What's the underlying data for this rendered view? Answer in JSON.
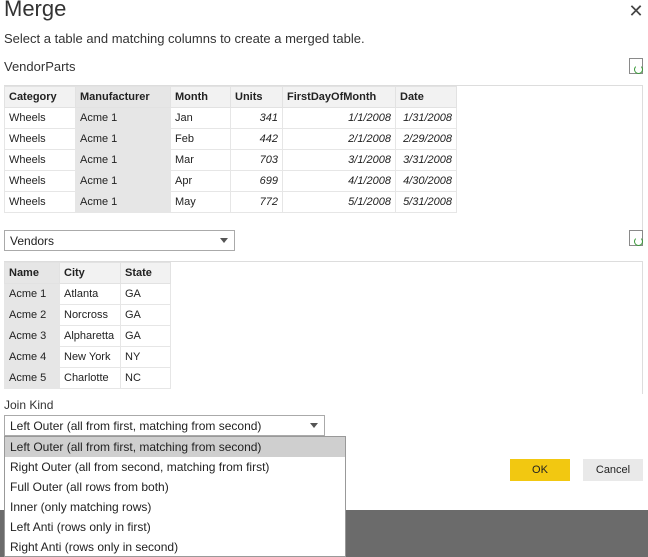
{
  "dialog": {
    "title": "Merge",
    "close_symbol": "✕",
    "subtitle": "Select a table and matching columns to create a merged table."
  },
  "first_table": {
    "name": "VendorParts",
    "columns": [
      "Category",
      "Manufacturer",
      "Month",
      "Units",
      "FirstDayOfMonth",
      "Date"
    ],
    "rows": [
      [
        "Wheels",
        "Acme 1",
        "Jan",
        "341",
        "1/1/2008",
        "1/31/2008"
      ],
      [
        "Wheels",
        "Acme 1",
        "Feb",
        "442",
        "2/1/2008",
        "2/29/2008"
      ],
      [
        "Wheels",
        "Acme 1",
        "Mar",
        "703",
        "3/1/2008",
        "3/31/2008"
      ],
      [
        "Wheels",
        "Acme 1",
        "Apr",
        "699",
        "4/1/2008",
        "4/30/2008"
      ],
      [
        "Wheels",
        "Acme 1",
        "May",
        "772",
        "5/1/2008",
        "5/31/2008"
      ]
    ],
    "selected_column": "Manufacturer"
  },
  "second_table": {
    "selected": "Vendors",
    "columns": [
      "Name",
      "City",
      "State"
    ],
    "rows": [
      [
        "Acme 1",
        "Atlanta",
        "GA"
      ],
      [
        "Acme 2",
        "Norcross",
        "GA"
      ],
      [
        "Acme 3",
        "Alpharetta",
        "GA"
      ],
      [
        "Acme 4",
        "New York",
        "NY"
      ],
      [
        "Acme 5",
        "Charlotte",
        "NC"
      ]
    ],
    "selected_column": "Name"
  },
  "join": {
    "label": "Join Kind",
    "selected": "Left Outer (all from first, matching from second)",
    "options": [
      "Left Outer (all from first, matching from second)",
      "Right Outer (all from second, matching from first)",
      "Full Outer (all rows from both)",
      "Inner (only matching rows)",
      "Left Anti (rows only in first)",
      "Right Anti (rows only in second)"
    ]
  },
  "buttons": {
    "ok": "OK",
    "cancel": "Cancel"
  },
  "colors": {
    "ok_button": "#f2c811",
    "selected_column": "#e6e6e6",
    "overlay": "#6b6b6b"
  },
  "icons": {
    "refresh": "refresh-preview-icon",
    "close": "close-icon",
    "dropdown": "chevron-down-icon"
  }
}
